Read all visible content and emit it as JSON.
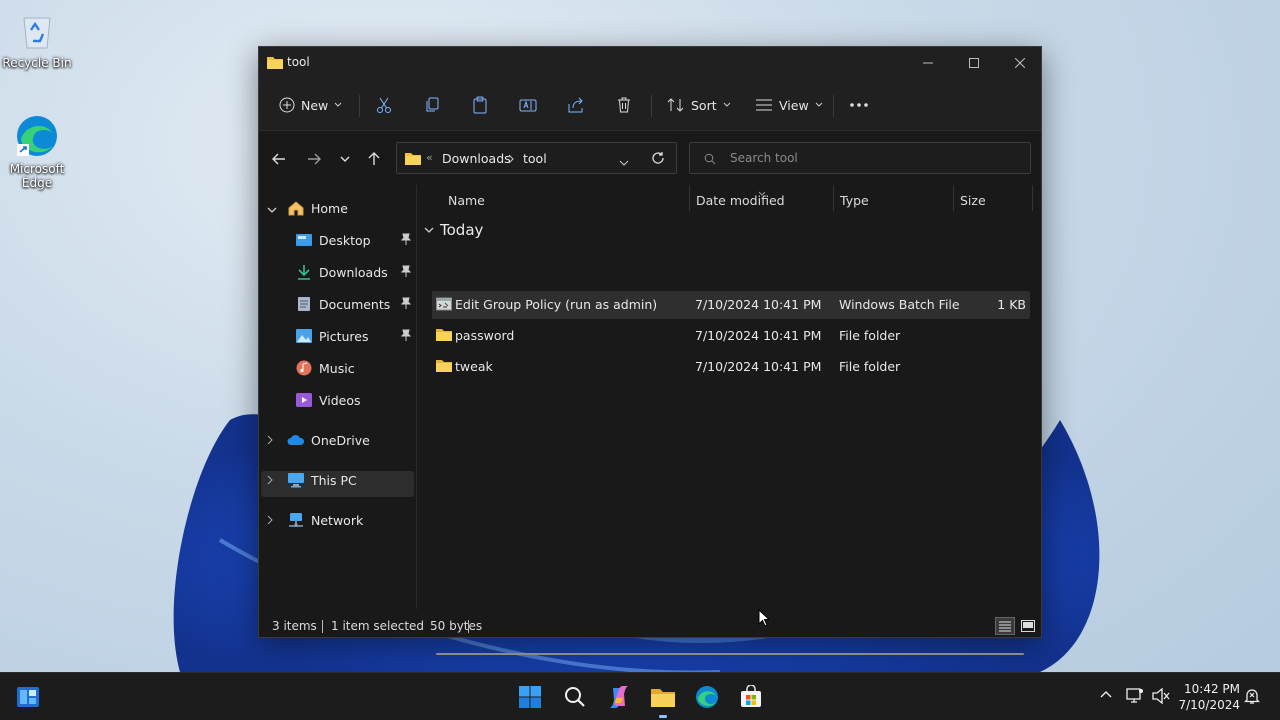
{
  "desktop": {
    "icons": [
      {
        "label": "Recycle Bin"
      },
      {
        "label": "Microsoft Edge"
      }
    ]
  },
  "window": {
    "title": "tool",
    "toolbar": {
      "new_label": "New",
      "sort_label": "Sort",
      "view_label": "View"
    },
    "address": {
      "crumbs": [
        "Downloads",
        "tool"
      ],
      "overflow": "«"
    },
    "search": {
      "placeholder": "Search tool"
    },
    "sidebar": {
      "items": [
        {
          "label": "Home"
        },
        {
          "label": "Desktop"
        },
        {
          "label": "Downloads"
        },
        {
          "label": "Documents"
        },
        {
          "label": "Pictures"
        },
        {
          "label": "Music"
        },
        {
          "label": "Videos"
        },
        {
          "label": "OneDrive"
        },
        {
          "label": "This PC"
        },
        {
          "label": "Network"
        }
      ]
    },
    "columns": [
      "Name",
      "Date modified",
      "Type",
      "Size"
    ],
    "group_label": "Today",
    "files": [
      {
        "name": "Edit Group Policy (run as admin)",
        "date": "7/10/2024 10:41 PM",
        "type": "Windows Batch File",
        "size": "1 KB"
      },
      {
        "name": "password",
        "date": "7/10/2024 10:41 PM",
        "type": "File folder",
        "size": ""
      },
      {
        "name": "tweak",
        "date": "7/10/2024 10:41 PM",
        "type": "File folder",
        "size": ""
      }
    ],
    "status": {
      "count": "3 items",
      "selected": "1 item selected",
      "size": "50 bytes"
    }
  },
  "taskbar": {
    "time": "10:42 PM",
    "date": "7/10/2024"
  },
  "colors": {
    "folder": "#f0c040",
    "accent": "#0078d4",
    "window_bg": "#191919"
  }
}
